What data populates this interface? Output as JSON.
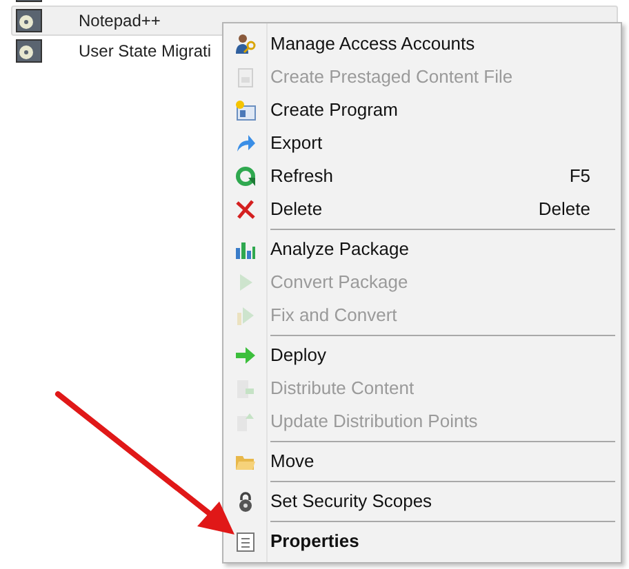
{
  "list": {
    "rows": [
      {
        "name": "",
        "selected": false
      },
      {
        "name": "Notepad++",
        "selected": true
      },
      {
        "name": "User State Migrati",
        "selected": false
      }
    ]
  },
  "context_menu": {
    "items": [
      {
        "label": "Manage Access Accounts",
        "disabled": false
      },
      {
        "label": "Create Prestaged Content File",
        "disabled": true
      },
      {
        "label": "Create Program",
        "disabled": false
      },
      {
        "label": "Export",
        "disabled": false
      },
      {
        "label": "Refresh",
        "disabled": false,
        "shortcut": "F5"
      },
      {
        "label": "Delete",
        "disabled": false,
        "shortcut": "Delete",
        "separator_after": true
      },
      {
        "label": "Analyze Package",
        "disabled": false
      },
      {
        "label": "Convert Package",
        "disabled": true
      },
      {
        "label": "Fix and Convert",
        "disabled": true,
        "separator_after": true
      },
      {
        "label": "Deploy",
        "disabled": false
      },
      {
        "label": "Distribute Content",
        "disabled": true
      },
      {
        "label": "Update Distribution Points",
        "disabled": true,
        "separator_after": true
      },
      {
        "label": "Move",
        "disabled": false,
        "separator_after": true
      },
      {
        "label": "Set Security Scopes",
        "disabled": false,
        "separator_after": true
      },
      {
        "label": "Properties",
        "disabled": false,
        "default": true
      }
    ]
  }
}
